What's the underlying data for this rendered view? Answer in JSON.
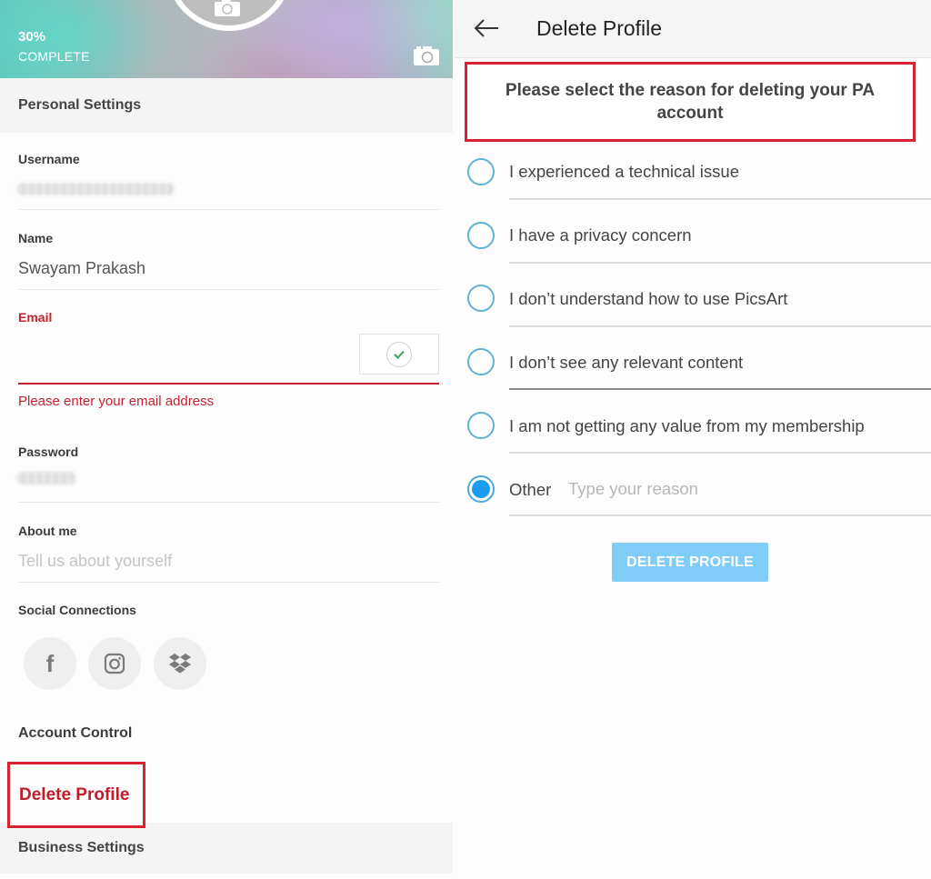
{
  "profile_panel": {
    "banner": {
      "completion_percent": "30%",
      "completion_label": "COMPLETE",
      "avatar_icon": "camera-icon",
      "cover_icon": "camera-icon"
    },
    "personal_settings_header": "Personal Settings",
    "fields": {
      "username": {
        "label": "Username",
        "value": "(blurred)"
      },
      "name": {
        "label": "Name",
        "value": "Swayam Prakash"
      },
      "email": {
        "label": "Email",
        "value": "",
        "error": "Please enter your email address",
        "verify_icon": "check-circle-icon"
      },
      "password": {
        "label": "Password",
        "value": "(blurred)"
      },
      "about": {
        "label": "About me",
        "placeholder": "Tell us about yourself"
      }
    },
    "social_connections": {
      "label": "Social Connections",
      "items": [
        {
          "name": "Facebook",
          "icon": "facebook-icon",
          "glyph": "f"
        },
        {
          "name": "Instagram",
          "icon": "instagram-icon"
        },
        {
          "name": "Dropbox",
          "icon": "dropbox-icon"
        }
      ]
    },
    "account_control": {
      "label": "Account Control",
      "delete_link": "Delete Profile"
    },
    "business_settings_header": "Business Settings"
  },
  "delete_panel": {
    "title": "Delete Profile",
    "back_icon": "arrow-left-icon",
    "prompt": "Please select the reason for deleting your PA account",
    "reasons": [
      {
        "label": "I experienced a technical issue",
        "selected": false
      },
      {
        "label": "I have a privacy concern",
        "selected": false
      },
      {
        "label": "I don’t understand how to use PicsArt",
        "selected": false
      },
      {
        "label": "I don’t see any relevant content",
        "selected": false
      },
      {
        "label": "I am not getting any value from my membership",
        "selected": false
      },
      {
        "label": "Other",
        "selected": true,
        "input_placeholder": "Type your reason"
      }
    ],
    "delete_button": "DELETE PROFILE"
  },
  "colors": {
    "error_red": "#c8202f",
    "highlight_red": "#d7222f",
    "radio_blue": "#1a9cf0",
    "button_blue_disabled": "#7fcdf8"
  }
}
